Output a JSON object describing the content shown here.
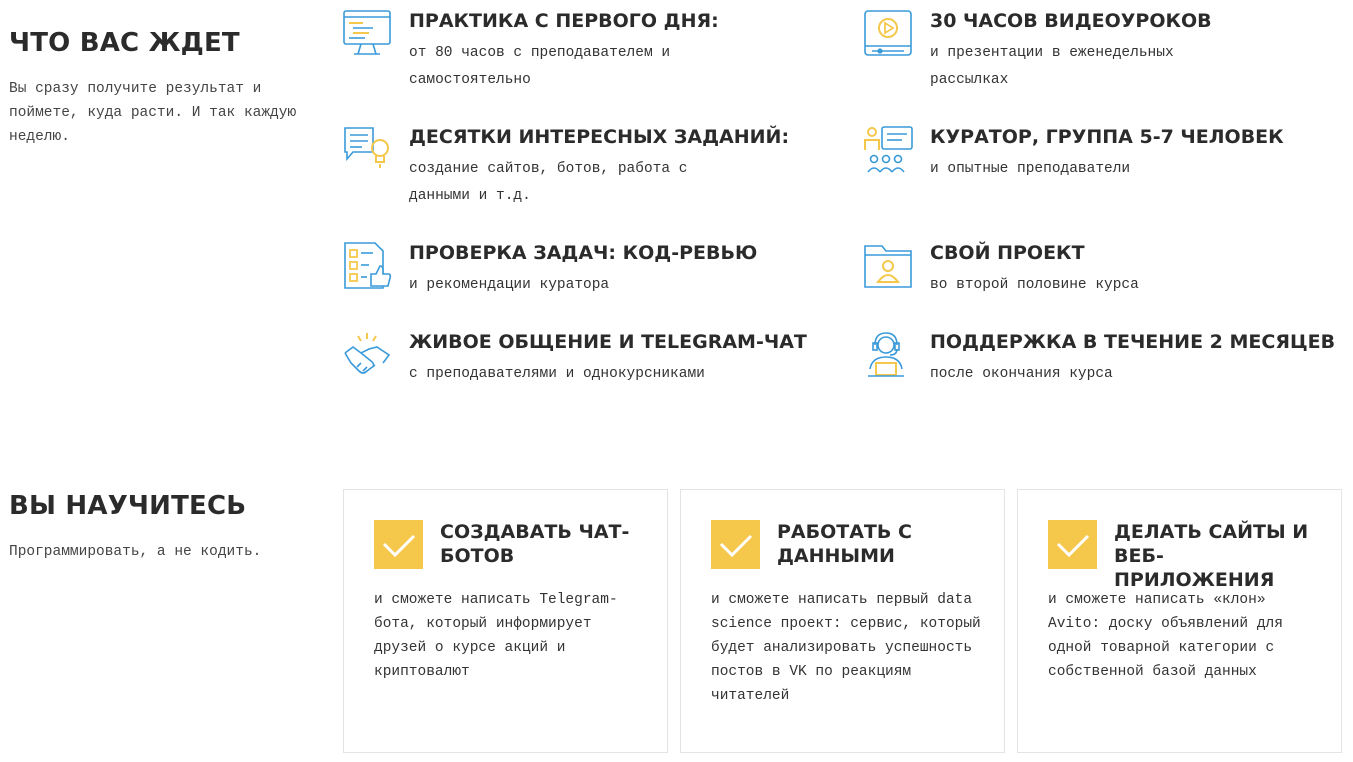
{
  "expect": {
    "title": "ЧТО ВАС ЖДЕТ",
    "subtitle": "Вы сразу получите результат и поймете, куда расти. И так каждую неделю.",
    "features": [
      {
        "icon": "monitor-code-icon",
        "title": "ПРАКТИКА С ПЕРВОГО ДНЯ:",
        "desc": "от 80 часов с преподавателем и самостоятельно"
      },
      {
        "icon": "video-player-icon",
        "title": "30 ЧАСОВ ВИДЕОУРОКОВ",
        "desc": "и презентации в еженедельных рассылках"
      },
      {
        "icon": "chat-idea-icon",
        "title": "ДЕСЯТКИ ИНТЕРЕСНЫХ ЗАДАНИЙ:",
        "desc": "создание сайтов, ботов, работа с данными и т.д."
      },
      {
        "icon": "curator-group-icon",
        "title": "КУРАТОР, ГРУППА 5-7 ЧЕЛОВЕК",
        "desc": "и опытные преподаватели"
      },
      {
        "icon": "checklist-thumb-icon",
        "title": "ПРОВЕРКА ЗАДАЧ: КОД-РЕВЬЮ",
        "desc": "и рекомендации куратора"
      },
      {
        "icon": "folder-profile-icon",
        "title": "СВОЙ ПРОЕКТ",
        "desc": "во второй половине курса"
      },
      {
        "icon": "handshake-icon",
        "title": "ЖИВОЕ ОБЩЕНИЕ И TELEGRAM-ЧАТ",
        "desc": "с преподавателями и однокурсниками"
      },
      {
        "icon": "headset-support-icon",
        "title": "ПОДДЕРЖКА В ТЕЧЕНИЕ 2 МЕСЯЦЕВ",
        "desc": "после окончания курса"
      }
    ]
  },
  "learn": {
    "title": "ВЫ НАУЧИТЕСЬ",
    "subtitle": "Программировать, а не кодить.",
    "cards": [
      {
        "title": "СОЗДАВАТЬ ЧАТ-БОТОВ",
        "desc": "и сможете написать Telegram-бота, который информирует друзей о курсе акций и криптовалют"
      },
      {
        "title": "РАБОТАТЬ С ДАННЫМИ",
        "desc": "и сможете написать первый data science проект: сервис, который будет анализировать успешность постов в VK по реакциям читателей"
      },
      {
        "title": "ДЕЛАТЬ САЙТЫ И ВЕБ-ПРИЛОЖЕНИЯ",
        "desc": "и сможете написать «клон» Avito: доску объявлений для одной товарной категории с собственной базой данных"
      }
    ]
  },
  "colors": {
    "accent_yellow": "#f5c84c",
    "icon_blue": "#3a9ad9",
    "text": "#2b2b2b"
  }
}
